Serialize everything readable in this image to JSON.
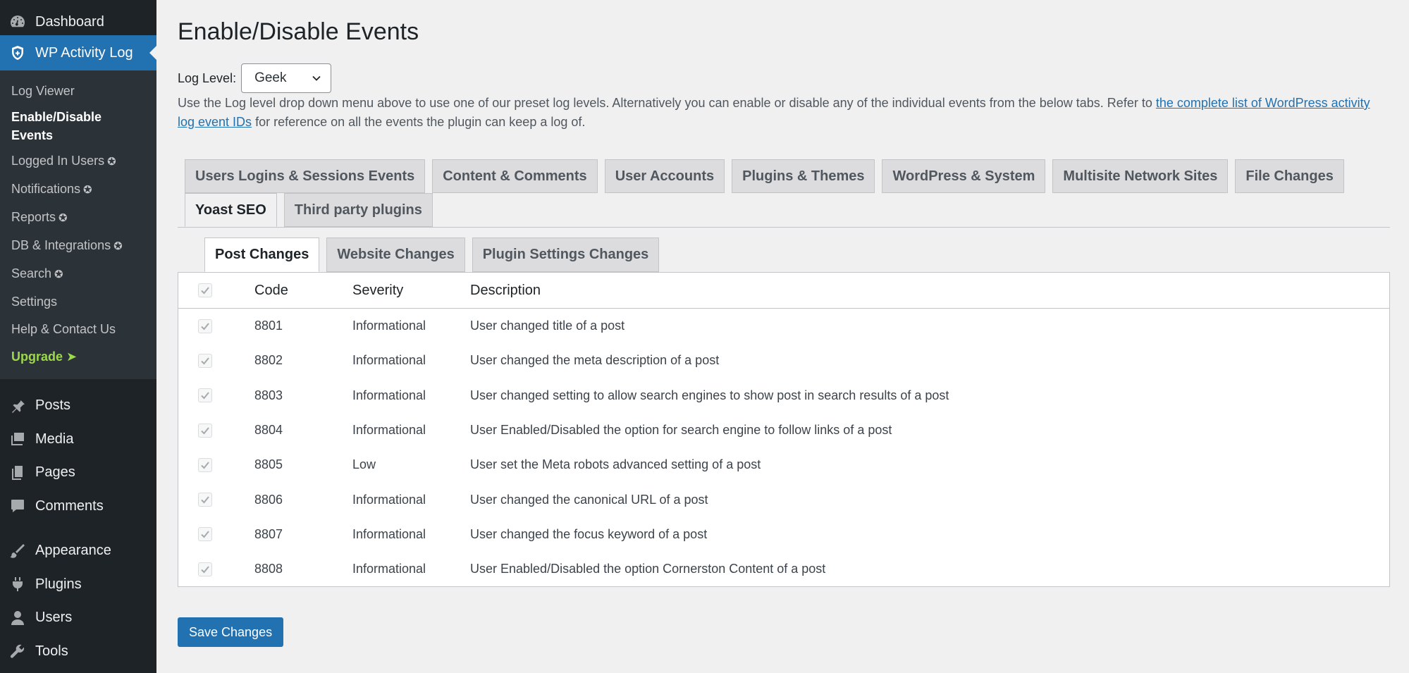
{
  "sidebar": {
    "dashboard": "Dashboard",
    "plugin": "WP Activity Log",
    "submenu": [
      {
        "label": "Log Viewer",
        "star": ""
      },
      {
        "label": "Enable/Disable Events",
        "star": ""
      },
      {
        "label": "Logged In Users",
        "star": "✪"
      },
      {
        "label": "Notifications",
        "star": "✪"
      },
      {
        "label": "Reports",
        "star": "✪"
      },
      {
        "label": "DB & Integrations",
        "star": "✪"
      },
      {
        "label": "Search",
        "star": "✪"
      },
      {
        "label": "Settings",
        "star": ""
      },
      {
        "label": "Help & Contact Us",
        "star": ""
      },
      {
        "label": "Upgrade ➤",
        "star": ""
      }
    ],
    "lower": [
      "Posts",
      "Media",
      "Pages",
      "Comments",
      "Appearance",
      "Plugins",
      "Users",
      "Tools"
    ]
  },
  "page": {
    "title": "Enable/Disable Events",
    "log_level_label": "Log Level:",
    "log_level_value": "Geek",
    "intro_text": "Use the Log level drop down menu above to use one of our preset log levels. Alternatively you can enable or disable any of the individual events from the below tabs. Refer to ",
    "intro_link": "the complete list of WordPress activity log event IDs",
    "intro_after": " for reference on all the events the plugin can keep a log of."
  },
  "tabs": {
    "row1": [
      "Users Logins & Sessions Events",
      "Content & Comments",
      "User Accounts",
      "Plugins & Themes",
      "WordPress & System",
      "Multisite Network Sites",
      "File Changes"
    ],
    "row2": [
      "Yoast SEO",
      "Third party plugins"
    ],
    "active": "Yoast SEO"
  },
  "subtabs": [
    "Post Changes",
    "Website Changes",
    "Plugin Settings Changes"
  ],
  "table": {
    "headers": {
      "code": "Code",
      "severity": "Severity",
      "description": "Description"
    },
    "rows": [
      {
        "code": "8801",
        "severity": "Informational",
        "description": "User changed title of a post"
      },
      {
        "code": "8802",
        "severity": "Informational",
        "description": "User changed the meta description of a post"
      },
      {
        "code": "8803",
        "severity": "Informational",
        "description": "User changed setting to allow search engines to show post in search results of a post"
      },
      {
        "code": "8804",
        "severity": "Informational",
        "description": "User Enabled/Disabled the option for search engine to follow links of a post"
      },
      {
        "code": "8805",
        "severity": "Low",
        "description": "User set the Meta robots advanced setting of a post"
      },
      {
        "code": "8806",
        "severity": "Informational",
        "description": "User changed the canonical URL of a post"
      },
      {
        "code": "8807",
        "severity": "Informational",
        "description": "User changed the focus keyword of a post"
      },
      {
        "code": "8808",
        "severity": "Informational",
        "description": "User Enabled/Disabled the option Cornerston Content of a post"
      }
    ]
  },
  "save_button": "Save Changes",
  "colors": {
    "sidebar_bg": "#1d2327",
    "accent": "#2271b1",
    "upgrade": "#9cd84a"
  }
}
